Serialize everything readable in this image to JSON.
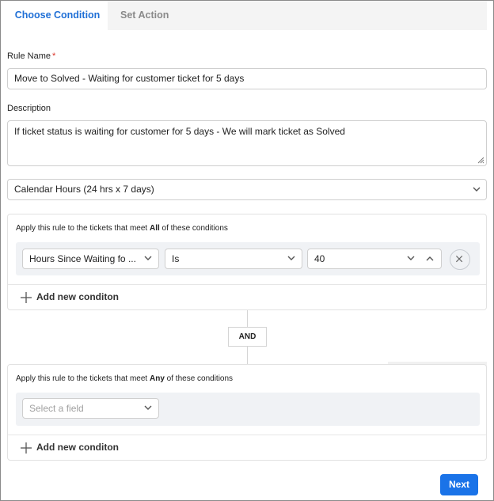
{
  "tabs": [
    {
      "label": "Choose Condition",
      "active": true
    },
    {
      "label": "Set Action",
      "active": false
    }
  ],
  "rule_name": {
    "label": "Rule Name",
    "required_mark": "*",
    "value": "Move to Solved - Waiting for customer ticket for 5 days"
  },
  "description": {
    "label": "Description",
    "value": "If ticket status is waiting for customer for 5 days - We will mark ticket as Solved"
  },
  "calendar": {
    "selected": "Calendar Hours (24 hrs x 7 days)"
  },
  "all_group": {
    "title_prefix": "Apply this rule to the tickets that meet ",
    "title_emphasis": "All",
    "title_suffix": " of these conditions",
    "condition": {
      "field": "Hours Since Waiting fo ...",
      "operator": "Is",
      "value": "40"
    },
    "add_label": "Add new conditon"
  },
  "connector": "AND",
  "any_group": {
    "title_prefix": "Apply this rule to the tickets that meet ",
    "title_emphasis": "Any",
    "title_suffix": " of these conditions",
    "field_placeholder": "Select a field",
    "add_label": "Add new conditon"
  },
  "next_label": "Next",
  "colors": {
    "accent": "#1a73e8",
    "active_tab": "#1f6fd6",
    "required": "#d93025"
  }
}
